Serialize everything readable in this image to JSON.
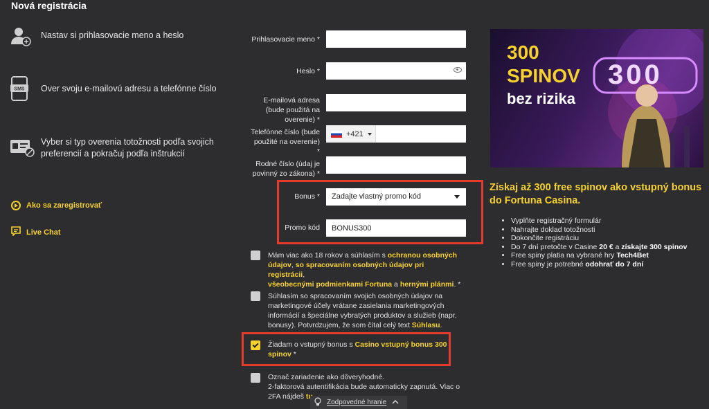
{
  "page": {
    "title": "Nová registrácia"
  },
  "steps": [
    {
      "icon": "user-add-icon",
      "text": "Nastav si prihlasovacie meno a heslo"
    },
    {
      "icon": "sms-phone-icon",
      "text": "Over svoju e-mailovú adresu a telefónne číslo"
    },
    {
      "icon": "id-card-icon",
      "text_line1": "Vyber si typ overenia totožnosti podľa svojich",
      "text_line2": "preferencií a pokračuj podľa inštrukcií"
    }
  ],
  "links": {
    "how_to": "Ako sa zaregistrovať",
    "live_chat": "Live Chat"
  },
  "form": {
    "username_label": "Prihlasovacie meno *",
    "password_label": "Heslo *",
    "email_label_1": "E-mailová adresa",
    "email_label_2": "(bude použitá na",
    "email_label_3": "overenie) *",
    "phone_label_1": "Telefónne číslo (bude",
    "phone_label_2": "použité na overenie) *",
    "phone_prefix": "+421",
    "birth_label_1": "Rodné číslo (údaj je",
    "birth_label_2": "povinný zo zákona) *",
    "bonus_label": "Bonus *",
    "bonus_value": "Zadajte vlastný promo kód",
    "promo_label": "Promo kód",
    "promo_value": "BONUS300"
  },
  "consents": {
    "c1_a": "Mám viac ako 18 rokov a súhlasím s ",
    "c1_link1": "ochranou osobných",
    "c1_link1b": "údajov",
    "c1_b": ", ",
    "c1_link2": "so spracovaním osobných údajov pri registrácii",
    "c1_c": ",",
    "c1_link3": "všeobecnými podmienkami Fortuna",
    "c1_d": " a ",
    "c1_link4": "hernými plánmi",
    "c1_e": ". *",
    "c2_line1": "Súhlasím so spracovaním svojich osobných údajov na",
    "c2_line2": "marketingové účely vrátane zasielania marketingových",
    "c2_line3": "informácií a špeciálne vybratých produktov a služieb (napr.",
    "c2_line4a": "bonusy). Potvrdzujem, že som čítal celý text ",
    "c2_link": "Súhlasu",
    "c2_line4b": ".",
    "c3_a": "Žiadam o vstupný bonus s ",
    "c3_link": "Casino vstupný bonus 300",
    "c3_link2": "spinov",
    "c3_b": " *",
    "c4_line1": "Označ zariadenie ako dôveryhodné.",
    "c4_line2": "2-faktorová autentifikácia bude automaticky zapnutá. Viac o",
    "c4_line3a": "2FA nájdeš ",
    "c4_link": "tu"
  },
  "promo": {
    "banner_line1": "300",
    "banner_line2": "SPINOV",
    "banner_line3": "bez rizika",
    "banner_big_number": "300",
    "headline": "Získaj až 300 free spinov ako vstupný bonus do Fortuna Casina.",
    "items": [
      {
        "text": "Vyplňte registračný formulár"
      },
      {
        "text": "Nahrajte doklad totožnosti"
      },
      {
        "text": "Dokončite registráciu"
      },
      {
        "text_a": "Do 7 dní pretočte v Casine ",
        "bold1": "20 €",
        "text_b": " a ",
        "bold2": "získajte 300 spinov"
      },
      {
        "text_a": "Free spiny platia na vybrané hry ",
        "bold1": "Tech4Bet"
      },
      {
        "text_a": "Free spiny je potrebné ",
        "bold1": "odohrať do 7 dní"
      }
    ]
  },
  "footer": {
    "responsible": "Zodpovedné hranie"
  },
  "colors": {
    "accent": "#f6d22c",
    "highlight": "#e53b2c",
    "background": "#2d2d2f"
  }
}
